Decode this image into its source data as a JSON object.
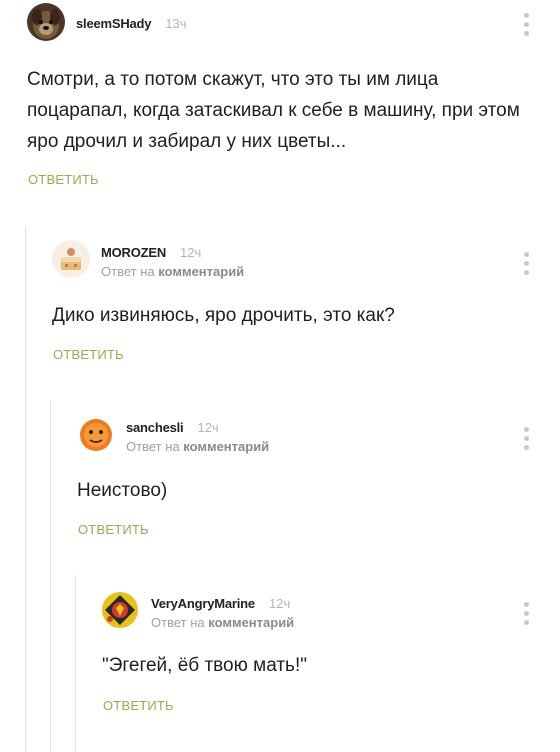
{
  "comments": [
    {
      "username": "sleemSHady",
      "time": "13ч",
      "reply_prefix": "",
      "reply_link": "",
      "text": "Смотри, а то потом скажут, что это ты им лица поцарапал, когда затаскивал к себе в машину, при этом яро дрочил и забирал у них цветы...",
      "reply_label": "ОТВЕТИТЬ",
      "avatar_icon": "dog-avatar"
    },
    {
      "username": "MOROZEN",
      "time": "12ч",
      "reply_prefix": "Ответ на",
      "reply_link": "комментарий",
      "text": "Дико извиняюсь, яро дрочить, это как?",
      "reply_label": "ОТВЕТИТЬ",
      "avatar_icon": "cake-avatar"
    },
    {
      "username": "sanchesli",
      "time": "12ч",
      "reply_prefix": "Ответ на",
      "reply_link": "комментарий",
      "text": "Неистово)",
      "reply_label": "ОТВЕТИТЬ",
      "avatar_icon": "orange-toy-avatar"
    },
    {
      "username": "VeryAngryMarine",
      "time": "12ч",
      "reply_prefix": "Ответ на",
      "reply_link": "комментарий",
      "text": "\"Эгегей, ёб твою мать!\"",
      "reply_label": "ОТВЕТИТЬ",
      "avatar_icon": "marine-emblem-avatar"
    }
  ],
  "colors": {
    "reply_button": "#88b44a",
    "thread_line": "#e3e3e3",
    "muted_text": "#a0a0a0"
  }
}
